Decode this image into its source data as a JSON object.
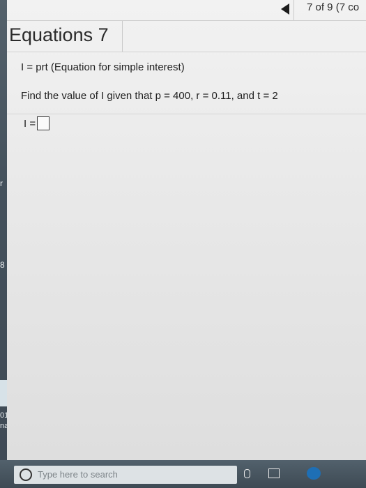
{
  "header": {
    "question_counter": "7 of 9 (7 co"
  },
  "page": {
    "title": "Equations 7"
  },
  "problem": {
    "formula_line": "I = prt (Equation for simple interest)",
    "instruction": "Find the value of I given that p = 400, r = 0.11, and t = 2",
    "answer_label": "I ="
  },
  "answer": {
    "value": "",
    "placeholder": ""
  },
  "left_edge": {
    "letter_top": "r",
    "letter_mid": "8",
    "text_1": "01",
    "text_2": "na"
  },
  "taskbar": {
    "search_placeholder": "Type here to search"
  },
  "icons": {
    "back": "left-triangle-icon",
    "search": "search-icon",
    "mic": "microphone-icon",
    "taskview": "task-view-icon",
    "edge": "edge-browser-icon"
  }
}
